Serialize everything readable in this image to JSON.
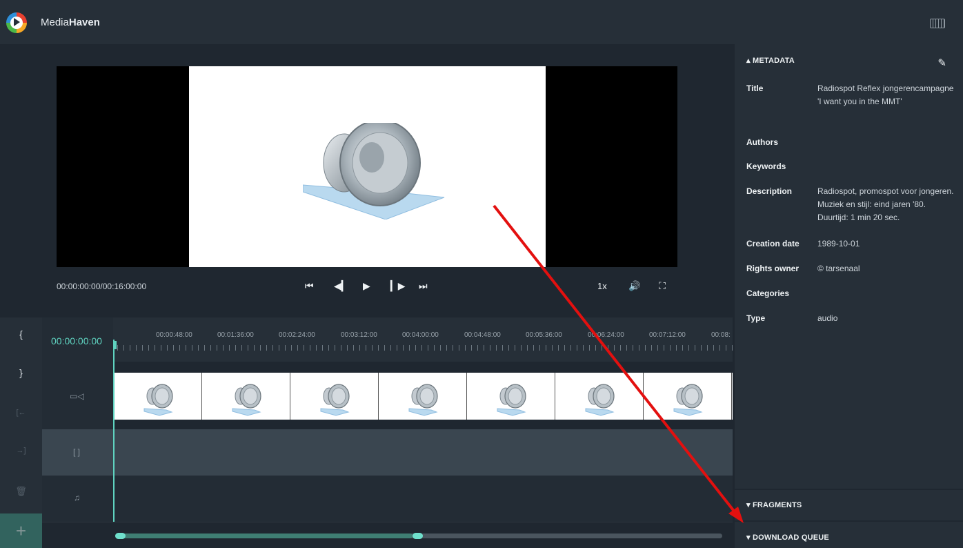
{
  "app": {
    "name_prefix": "Media",
    "name_bold": "Haven"
  },
  "player": {
    "timecode": "00:00:00:00/00:16:00:00",
    "speed": "1x",
    "controls": [
      "skip-to-start",
      "step-back",
      "play",
      "step-forward",
      "skip-to-end"
    ]
  },
  "timeline": {
    "current_time": "00:00:00:00",
    "ruler_labels": [
      "00:00:48:00",
      "00:01:36:00",
      "00:02:24:00",
      "00:03:12:00",
      "00:04:00:00",
      "00:04:48:00",
      "00:05:36:00",
      "00:06:24:00",
      "00:07:12:00",
      "00:08:"
    ],
    "tracks": [
      "video",
      "fragments",
      "audio"
    ],
    "scroll_position": 0.49
  },
  "tools": [
    {
      "glyph": "{",
      "name": "mark-in-icon"
    },
    {
      "glyph": "}",
      "name": "mark-out-icon"
    },
    {
      "glyph": "[←",
      "name": "go-to-in-icon"
    },
    {
      "glyph": "→]",
      "name": "go-to-out-icon"
    },
    {
      "glyph": "🗑",
      "name": "trash-icon"
    }
  ],
  "add_button": "+",
  "metadata": {
    "heading": "METADATA",
    "fields": [
      {
        "key": "Title",
        "value": "Radiospot Reflex jongerencampagne 'I want you in the MMT'"
      },
      {
        "key": "Authors",
        "value": ""
      },
      {
        "key": "Keywords",
        "value": ""
      },
      {
        "key": "Description",
        "value": "Radiospot, promospot voor jongeren. Muziek en stijl: eind jaren '80. Duurtijd: 1 min 20 sec."
      },
      {
        "key": "Creation date",
        "value": "1989-10-01"
      },
      {
        "key": "Rights owner",
        "value": "© tarsenaal"
      },
      {
        "key": "Categories",
        "value": ""
      },
      {
        "key": "Type",
        "value": "audio"
      }
    ]
  },
  "fragments": {
    "heading": "FRAGMENTS"
  },
  "download_queue": {
    "heading": "DOWNLOAD QUEUE"
  },
  "colors": {
    "accent": "#5fd3c0",
    "annotation": "#e3100f",
    "panel": "#262f38"
  }
}
